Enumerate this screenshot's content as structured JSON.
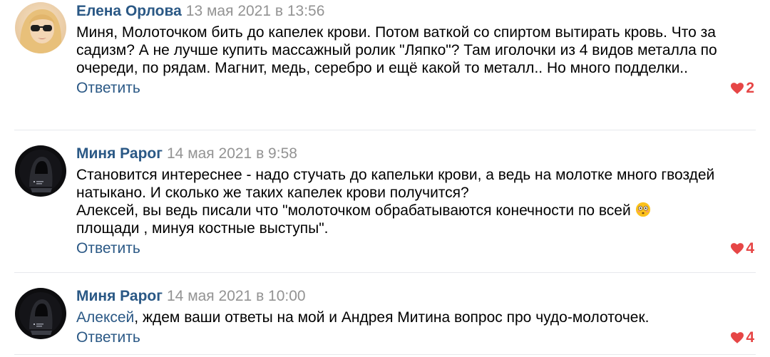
{
  "colors": {
    "author": "#2a5885",
    "date": "#939393",
    "link": "#2a5885",
    "like": "#e64646",
    "separator": "#e7e8ec"
  },
  "comments": [
    {
      "author": "Елена Орлова",
      "date": "13 мая 2021 в 13:56",
      "lines": [
        "Миня, Молоточком бить до капелек крови. Потом ваткой со спиртом вытирать кровь. Что за садизм? А не лучше купить массажный ролик \"Ляпко\"? Там иголочки из 4 видов металла по очереди, по рядам. Магнит, медь, серебро и ещё какой то металл.. Но много подделки.."
      ],
      "reply_label": "Ответить",
      "likes": "2",
      "avatar_icon": "woman-photo-avatar"
    },
    {
      "author": "Миня Рарог",
      "date": "14 мая 2021 в 9:58",
      "lines": [
        "Становится интереснее - надо стучать до капельки крови, а ведь на молотке много гвоздей натыкано. И сколько же таких капелек крови получится?",
        "Алексей, вы ведь писали что \"молоточком обрабатываются конечности по всей",
        "площади , минуя костные выступы\"."
      ],
      "emoji": "flushed-face-emoji",
      "reply_label": "Ответить",
      "likes": "4",
      "avatar_icon": "hooded-figure-avatar"
    },
    {
      "author": "Миня Рарог",
      "date": "14 мая 2021 в 10:00",
      "mention": "Алексей",
      "text_after_mention": ", ждем ваши ответы на мой и Андрея Митина вопрос про чудо-молоточек.",
      "reply_label": "Ответить",
      "likes": "4",
      "avatar_icon": "hooded-figure-avatar"
    }
  ]
}
